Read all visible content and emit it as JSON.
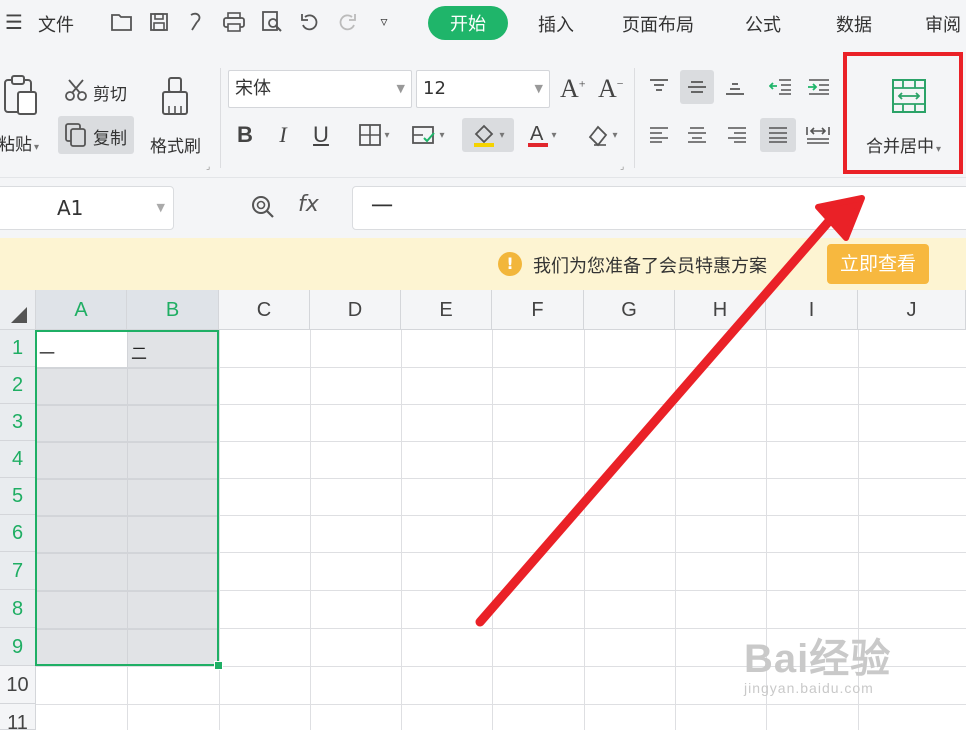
{
  "menubar": {
    "file_label": "文件",
    "tabs": [
      "开始",
      "插入",
      "页面布局",
      "公式",
      "数据",
      "审阅"
    ],
    "active_tab": "开始"
  },
  "ribbon": {
    "paste_label": "粘贴",
    "cut_label": "剪切",
    "copy_label": "复制",
    "format_painter_label": "格式刷",
    "font_name": "宋体",
    "font_size": "12",
    "merge_center_label": "合并居中"
  },
  "formula_bar": {
    "cell_ref": "A1",
    "fx_label": "fx",
    "value": "一"
  },
  "notice": {
    "text": "我们为您准备了会员特惠方案",
    "button": "立即查看"
  },
  "sheet": {
    "columns": [
      "A",
      "B",
      "C",
      "D",
      "E",
      "F",
      "G",
      "H",
      "I",
      "J"
    ],
    "rows": [
      "1",
      "2",
      "3",
      "4",
      "5",
      "6",
      "7",
      "8",
      "9",
      "10",
      "11"
    ],
    "cells": {
      "A1": "一",
      "B1": "二"
    },
    "selected_range": "A1:B9"
  },
  "watermark": {
    "brand": "Bai经验",
    "url": "jingyan.baidu.com"
  },
  "colors": {
    "accent_green": "#1fb56a",
    "highlight_red": "#ea2127",
    "notice_bg": "#fdf4d2",
    "notice_button": "#f7b83f"
  }
}
